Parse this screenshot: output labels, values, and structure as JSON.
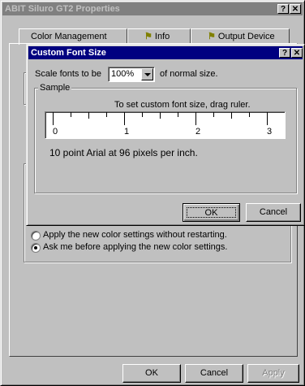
{
  "main_window": {
    "title": "ABIT Siluro GT2 Properties",
    "help_btn": "?",
    "close_btn": "✕",
    "tabs": [
      {
        "label": "Color Management"
      },
      {
        "label": "Info"
      },
      {
        "label": "Output Device"
      }
    ],
    "radio_options": [
      {
        "label": "Apply the new color settings without restarting.",
        "selected": false
      },
      {
        "label": "Ask me before applying the new color settings.",
        "selected": true
      }
    ],
    "buttons": {
      "ok": "OK",
      "cancel": "Cancel",
      "apply": "Apply"
    }
  },
  "dialog": {
    "title": "Custom Font Size",
    "help_btn": "?",
    "close_btn": "✕",
    "scale_prefix": "Scale fonts to be",
    "scale_value": "100%",
    "scale_suffix": "of normal size.",
    "sample_label": "Sample",
    "ruler_instruction": "To set custom font size, drag ruler.",
    "ruler_labels": [
      "0",
      "1",
      "2",
      "3"
    ],
    "sample_text": "10 point Arial at 96 pixels per inch.",
    "buttons": {
      "ok": "OK",
      "cancel": "Cancel"
    }
  },
  "colors": {
    "title_active": "#000080",
    "title_inactive": "#808080",
    "face": "#c0c0c0"
  }
}
